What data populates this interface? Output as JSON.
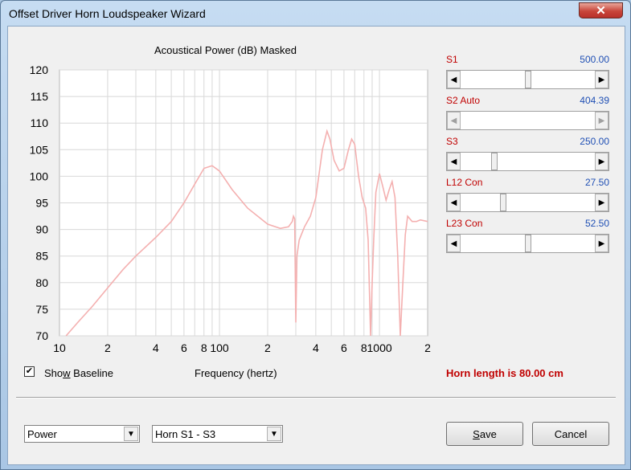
{
  "window": {
    "title": "Offset Driver Horn Loudspeaker Wizard",
    "close_label": "✕"
  },
  "chart": {
    "title": "Acoustical Power (dB)   Masked"
  },
  "chart_data": {
    "type": "line",
    "title": "Acoustical Power (dB)   Masked",
    "xlabel": "Frequency (hertz)",
    "ylabel": "",
    "xscale": "log",
    "xlim": [
      10,
      2000
    ],
    "ylim": [
      70,
      120
    ],
    "grid": true,
    "y_ticks": [
      "120",
      "115",
      "110",
      "105",
      "100",
      "95",
      "90",
      "85",
      "80",
      "75",
      "70"
    ],
    "x_ticks": [
      {
        "v": 10,
        "label": "10"
      },
      {
        "v": 20,
        "label": "2"
      },
      {
        "v": 40,
        "label": "4"
      },
      {
        "v": 60,
        "label": "6"
      },
      {
        "v": 80,
        "label": "8"
      },
      {
        "v": 100,
        "label": "100"
      },
      {
        "v": 200,
        "label": "2"
      },
      {
        "v": 400,
        "label": "4"
      },
      {
        "v": 600,
        "label": "6"
      },
      {
        "v": 800,
        "label": "8"
      },
      {
        "v": 1000,
        "label": "1000"
      },
      {
        "v": 2000,
        "label": "2"
      }
    ],
    "color": "#f4b0b0",
    "series": [
      {
        "x": [
          11,
          13,
          16,
          20,
          25,
          30,
          40,
          50,
          60,
          70,
          80,
          90,
          100,
          120,
          150,
          200,
          240,
          270,
          285,
          290,
          295,
          300,
          305,
          315,
          340,
          370,
          400,
          440,
          470,
          490,
          520,
          560,
          600,
          640,
          670,
          700,
          740,
          780,
          820,
          850,
          880,
          900,
          920,
          950,
          1000,
          1050,
          1100,
          1150,
          1200,
          1250,
          1300,
          1350,
          1400,
          1450,
          1500,
          1600,
          1700,
          1800,
          2000
        ],
        "y": [
          70,
          72.5,
          75.5,
          79,
          82.5,
          85,
          88.5,
          91.5,
          95,
          98.5,
          101.5,
          102,
          101,
          97.5,
          94,
          91,
          90.2,
          90.5,
          91.5,
          92.5,
          92,
          72.5,
          85,
          88,
          90.5,
          92.5,
          96,
          105,
          108.5,
          107,
          103,
          101,
          101.5,
          105,
          107,
          106,
          100,
          96,
          94,
          88,
          70,
          80,
          88,
          97,
          100.5,
          98,
          95.5,
          97.5,
          99,
          96,
          85,
          70,
          80,
          89,
          92.5,
          91.5,
          91.5,
          91.8,
          91.5
        ]
      }
    ]
  },
  "sliders": [
    {
      "label": "S1",
      "value": "500.00",
      "pos": 0.5,
      "disabled": false
    },
    {
      "label": "S2  Auto",
      "value": "404.39",
      "pos": 0.0,
      "disabled": true
    },
    {
      "label": "S3",
      "value": "250.00",
      "pos": 0.24,
      "disabled": false
    },
    {
      "label": "L12  Con",
      "value": "27.50",
      "pos": 0.31,
      "disabled": false
    },
    {
      "label": "L23  Con",
      "value": "52.50",
      "pos": 0.5,
      "disabled": false
    }
  ],
  "show_baseline": {
    "checked": true,
    "label_pre": "Sho",
    "label_ul": "w",
    "label_post": " Baseline"
  },
  "x_axis_label": "Frequency (hertz)",
  "horn_length": "Horn length is 80.00 cm",
  "dropdown_mode": {
    "value": "Power"
  },
  "dropdown_horn": {
    "value": "Horn S1 - S3"
  },
  "buttons": {
    "save_ul": "S",
    "save_rest": "ave",
    "cancel": "Cancel"
  },
  "icons": {
    "check": "✔",
    "arrow_left": "◀",
    "arrow_right": "▶",
    "arrow_down": "▼"
  }
}
